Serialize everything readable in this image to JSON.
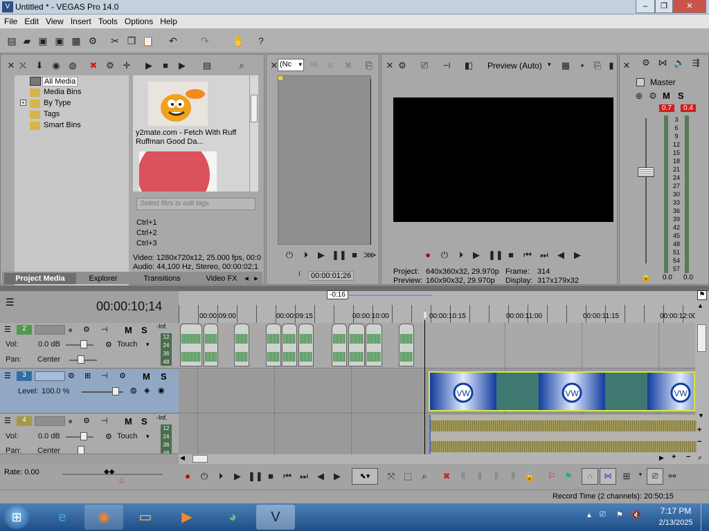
{
  "window": {
    "title": "Untitled * - VEGAS Pro 14.0",
    "min": "–",
    "max": "❐",
    "close": "✕"
  },
  "menu": [
    "File",
    "Edit",
    "View",
    "Insert",
    "Tools",
    "Options",
    "Help"
  ],
  "explorer": {
    "tree": [
      "All Media",
      "Media Bins",
      "By Type",
      "Tags",
      "Smart Bins"
    ],
    "expand": "+",
    "media": [
      {
        "caption": "y2mate.com - Fetch With Ruff Ruffman Good Da..."
      }
    ],
    "tag_placeholder": "Select files to edit tags",
    "shortcuts": [
      "Ctrl+1",
      "Ctrl+2",
      "Ctrl+3"
    ],
    "info_video": "Video: 1280x720x12, 25.000 fps, 00:0",
    "info_audio": "Audio: 44,100 Hz, Stereo, 00:00:02;1",
    "tabs": [
      "Project Media",
      "Explorer",
      "Transitions",
      "Video FX"
    ]
  },
  "trimmer": {
    "select": "(Nc",
    "timecode": "00:00:01;26"
  },
  "preview": {
    "quality": "Preview (Auto)",
    "project_label": "Project:",
    "project_value": "640x360x32, 29.970p",
    "preview_label": "Preview:",
    "preview_value": "160x90x32, 29.970p",
    "frame_label": "Frame:",
    "frame_value": "314",
    "display_label": "Display:",
    "display_value": "317x179x32"
  },
  "master": {
    "label": "Master",
    "m": "M",
    "s": "S",
    "peak_l": "0.7",
    "peak_r": "0.4",
    "scale": [
      "3",
      "6",
      "9",
      "12",
      "15",
      "18",
      "21",
      "24",
      "27",
      "30",
      "33",
      "36",
      "39",
      "42",
      "45",
      "48",
      "51",
      "54",
      "57"
    ],
    "foot_l": "0.0",
    "foot_r": "0.0"
  },
  "timeline": {
    "timecode": "00:00:10;14",
    "offset": "-0:16",
    "ticks": [
      "00:00:09:00",
      "00:00:09:15",
      "00:00:10:00",
      "00:00:10:15",
      "00:00:11:00",
      "00:00:11:15",
      "00:00:12:00"
    ]
  },
  "tracks": [
    {
      "num": "2",
      "vol_label": "Vol:",
      "vol": "0.0 dB",
      "pan_label": "Pan:",
      "pan": "Center",
      "mode": "Touch",
      "m": "M",
      "s": "S",
      "meter": [
        "-Inf.",
        "12",
        "24",
        "36",
        "48"
      ]
    },
    {
      "num": "3",
      "level_label": "Level:",
      "level": "100.0 %",
      "m": "M",
      "s": "S"
    },
    {
      "num": "4",
      "vol_label": "Vol:",
      "vol": "0.0 dB",
      "pan_label": "Pan:",
      "pan": "Center",
      "mode": "Touch",
      "m": "M",
      "s": "S",
      "meter": [
        "-Inf.",
        "12",
        "24",
        "36",
        "48"
      ]
    }
  ],
  "transport": {
    "rate": "Rate: 0.00",
    "record_time": "Record Time (2 channels): 20:50:15"
  },
  "clock": {
    "time": "7:17 PM",
    "date": "2/13/2025"
  }
}
